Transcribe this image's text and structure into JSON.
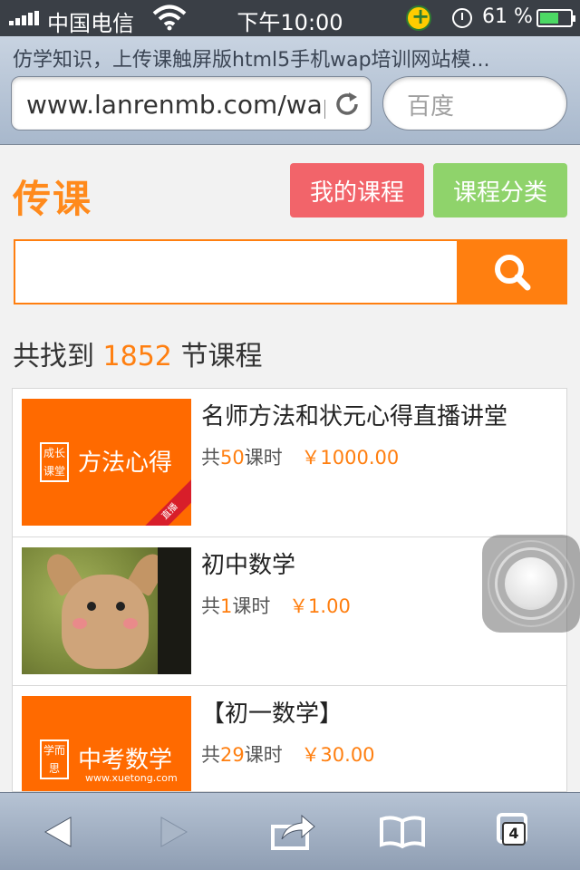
{
  "status_bar": {
    "carrier": "中国电信",
    "time": "下午10:00",
    "battery_percent": "61 %",
    "battery_level": 0.61
  },
  "browser": {
    "page_title": "仿学知识，上传课触屏版html5手机wap培训网站模...",
    "url": "www.lanrenmb.com/wap",
    "search_placeholder": "百度",
    "tabs_count": "4"
  },
  "header": {
    "logo": "传课",
    "my_courses": "我的课程",
    "categories": "课程分类"
  },
  "search": {
    "value": ""
  },
  "results": {
    "prefix": "共找到",
    "count": "1852",
    "suffix": "节课程"
  },
  "courses": [
    {
      "title": "名师方法和状元心得直播讲堂",
      "hours_prefix": "共",
      "hours": "50",
      "hours_suffix": "课时",
      "price": "￥1000.00",
      "thumb_label": "方法心得",
      "thumb_stamp": "成长课堂",
      "thumb_ribbon": "直播"
    },
    {
      "title": "初中数学",
      "hours_prefix": "共",
      "hours": "1",
      "hours_suffix": "课时",
      "price": "￥1.00"
    },
    {
      "title": "【初一数学】",
      "hours_prefix": "共",
      "hours": "29",
      "hours_suffix": "课时",
      "price": "￥30.00",
      "thumb_label": "中考数学",
      "thumb_stamp": "学而思",
      "thumb_site": "www.xuetong.com"
    }
  ],
  "icons": {
    "reload": "reload-icon",
    "search": "search-icon",
    "back": "back-arrow-icon",
    "forward": "forward-arrow-icon",
    "share": "share-icon",
    "bookmarks": "bookmarks-icon",
    "tabs": "tabs-icon"
  },
  "colors": {
    "accent_orange": "#ff7f10",
    "my_courses_bg": "#f2646a",
    "categories_bg": "#8fd36b"
  }
}
